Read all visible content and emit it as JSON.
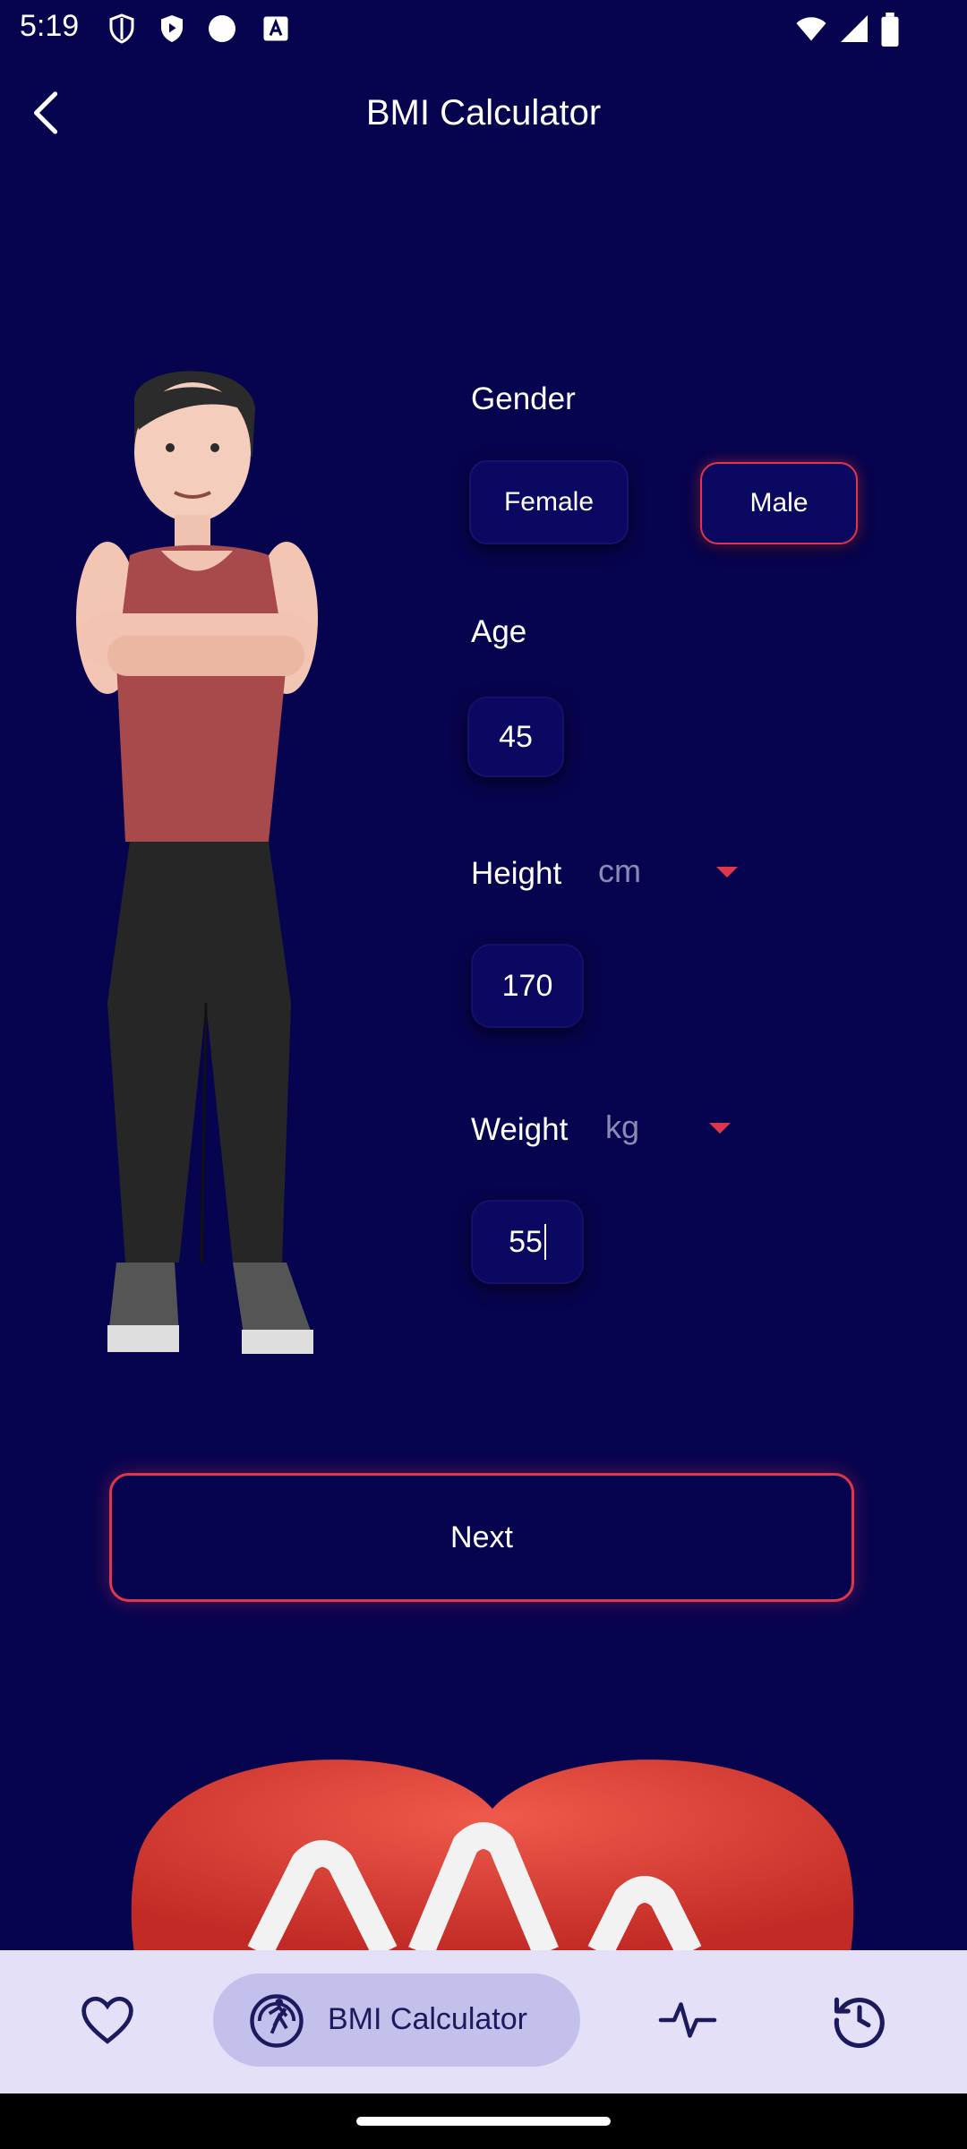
{
  "status_bar": {
    "time": "5:19"
  },
  "header": {
    "title": "BMI Calculator"
  },
  "form": {
    "gender_label": "Gender",
    "gender_options": [
      "Female",
      "Male"
    ],
    "gender_selected": "Male",
    "age_label": "Age",
    "age_value": "45",
    "height_label": "Height",
    "height_unit": "cm",
    "height_value": "170",
    "weight_label": "Weight",
    "weight_unit": "kg",
    "weight_value": "55"
  },
  "actions": {
    "next_label": "Next"
  },
  "bottom_nav": {
    "items": [
      {
        "icon": "heart-icon",
        "label": ""
      },
      {
        "icon": "bmi-scale-icon",
        "label": "BMI Calculator",
        "active": true
      },
      {
        "icon": "pulse-icon",
        "label": ""
      },
      {
        "icon": "history-icon",
        "label": ""
      }
    ]
  },
  "colors": {
    "background": "#07044F",
    "accent": "#E0364B",
    "field_bg": "#0B0861",
    "nav_bg": "#E3E0F8",
    "nav_active": "#C4C0EC"
  }
}
